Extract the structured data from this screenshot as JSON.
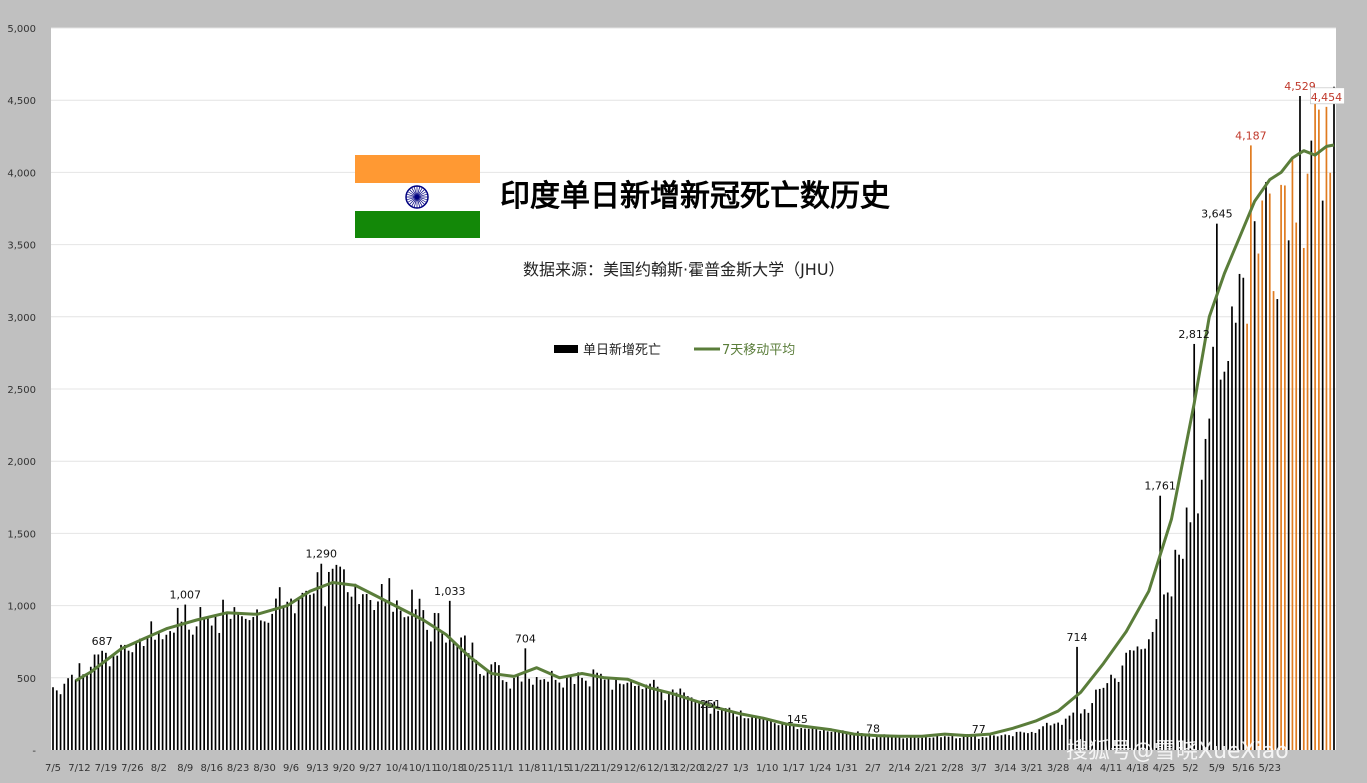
{
  "chart_data": {
    "type": "bar",
    "title": "印度单日新增新冠死亡数历史",
    "subtitle": "数据来源：美国约翰斯·霍普金斯大学（JHU）",
    "legend": {
      "placement": "center",
      "bar_label": "单日新增死亡",
      "line_label": "7天移动平均"
    },
    "watermark": "搜狐号@雪晓XueXiao",
    "ylim": [
      0,
      5000
    ],
    "y_ticks": [
      "-",
      "500",
      "1,000",
      "1,500",
      "2,000",
      "2,500",
      "3,000",
      "3,500",
      "4,000",
      "4,500",
      "5,000"
    ],
    "x_ticks": [
      "7/5",
      "7/12",
      "7/19",
      "7/26",
      "8/2",
      "8/9",
      "8/16",
      "8/23",
      "8/30",
      "9/6",
      "9/13",
      "9/20",
      "9/27",
      "10/4",
      "10/11",
      "10/18",
      "10/25",
      "11/1",
      "11/8",
      "11/15",
      "11/22",
      "11/29",
      "12/6",
      "12/13",
      "12/20",
      "12/27",
      "1/3",
      "1/10",
      "1/17",
      "1/24",
      "1/31",
      "2/7",
      "2/14",
      "2/21",
      "2/28",
      "3/7",
      "3/14",
      "3/21",
      "3/28",
      "4/4",
      "4/11",
      "4/18",
      "4/25",
      "5/2",
      "5/9",
      "5/16",
      "5/23"
    ],
    "series": [
      {
        "name": "单日新增死亡",
        "type": "bar",
        "colors": {
          "default": "#000000",
          "recent": "#e07b1f"
        },
        "keypoints": [
          {
            "day": 0,
            "value": 440
          },
          {
            "day": 14,
            "value": 680
          },
          {
            "day": 21,
            "value": 760
          },
          {
            "day": 35,
            "value": 920
          },
          {
            "day": 42,
            "value": 960
          },
          {
            "day": 56,
            "value": 1000
          },
          {
            "day": 63,
            "value": 1060
          },
          {
            "day": 70,
            "value": 1180
          },
          {
            "day": 77,
            "value": 1170
          },
          {
            "day": 84,
            "value": 1120
          },
          {
            "day": 91,
            "value": 1080
          },
          {
            "day": 98,
            "value": 960
          },
          {
            "day": 105,
            "value": 820
          },
          {
            "day": 112,
            "value": 680
          },
          {
            "day": 119,
            "value": 530
          },
          {
            "day": 126,
            "value": 530
          },
          {
            "day": 133,
            "value": 540
          },
          {
            "day": 140,
            "value": 510
          },
          {
            "day": 147,
            "value": 520
          },
          {
            "day": 154,
            "value": 500
          },
          {
            "day": 161,
            "value": 430
          },
          {
            "day": 168,
            "value": 380
          },
          {
            "day": 175,
            "value": 310
          },
          {
            "day": 182,
            "value": 250
          },
          {
            "day": 189,
            "value": 210
          },
          {
            "day": 196,
            "value": 170
          },
          {
            "day": 203,
            "value": 150
          },
          {
            "day": 210,
            "value": 130
          },
          {
            "day": 217,
            "value": 105
          },
          {
            "day": 224,
            "value": 95
          },
          {
            "day": 231,
            "value": 95
          },
          {
            "day": 238,
            "value": 100
          },
          {
            "day": 245,
            "value": 105
          },
          {
            "day": 252,
            "value": 100
          },
          {
            "day": 259,
            "value": 135
          },
          {
            "day": 266,
            "value": 200
          },
          {
            "day": 273,
            "value": 280
          },
          {
            "day": 280,
            "value": 520
          },
          {
            "day": 287,
            "value": 720
          },
          {
            "day": 294,
            "value": 1030
          },
          {
            "day": 301,
            "value": 1650
          },
          {
            "day": 308,
            "value": 2700
          },
          {
            "day": 315,
            "value": 3450
          },
          {
            "day": 322,
            "value": 3900
          },
          {
            "day": 329,
            "value": 4050
          },
          {
            "day": 336,
            "value": 4150
          },
          {
            "day": 339,
            "value": 4180
          }
        ],
        "recent_from_day": 315,
        "annotations": [
          {
            "day": 13,
            "value": 687,
            "label": "687"
          },
          {
            "day": 35,
            "value": 1007,
            "label": "1,007"
          },
          {
            "day": 71,
            "value": 1290,
            "label": "1,290"
          },
          {
            "day": 105,
            "value": 1033,
            "label": "1,033"
          },
          {
            "day": 125,
            "value": 704,
            "label": "704"
          },
          {
            "day": 174,
            "value": 251,
            "label": "251"
          },
          {
            "day": 197,
            "value": 145,
            "label": "145"
          },
          {
            "day": 217,
            "value": 78,
            "label": "78"
          },
          {
            "day": 245,
            "value": 77,
            "label": "77"
          },
          {
            "day": 271,
            "value": 714,
            "label": "714"
          },
          {
            "day": 293,
            "value": 1761,
            "label": "1,761"
          },
          {
            "day": 302,
            "value": 2812,
            "label": "2,812"
          },
          {
            "day": 308,
            "value": 3645,
            "label": "3,645"
          },
          {
            "day": 317,
            "value": 4187,
            "label": "4,187",
            "color": "#c0392b"
          },
          {
            "day": 330,
            "value": 4529,
            "label": "4,529",
            "color": "#c0392b"
          },
          {
            "day": 337,
            "value": 4454,
            "label": "4,454",
            "color": "#c0392b",
            "boxed": true
          }
        ]
      },
      {
        "name": "7天移动平均",
        "type": "line",
        "color": "#5a7d3a",
        "points": [
          {
            "day": 6,
            "value": 480
          },
          {
            "day": 10,
            "value": 540
          },
          {
            "day": 14,
            "value": 620
          },
          {
            "day": 18,
            "value": 700
          },
          {
            "day": 24,
            "value": 770
          },
          {
            "day": 30,
            "value": 840
          },
          {
            "day": 38,
            "value": 900
          },
          {
            "day": 46,
            "value": 950
          },
          {
            "day": 54,
            "value": 940
          },
          {
            "day": 62,
            "value": 1000
          },
          {
            "day": 68,
            "value": 1100
          },
          {
            "day": 74,
            "value": 1160
          },
          {
            "day": 80,
            "value": 1140
          },
          {
            "day": 86,
            "value": 1060
          },
          {
            "day": 92,
            "value": 980
          },
          {
            "day": 98,
            "value": 900
          },
          {
            "day": 104,
            "value": 800
          },
          {
            "day": 110,
            "value": 650
          },
          {
            "day": 116,
            "value": 530
          },
          {
            "day": 122,
            "value": 510
          },
          {
            "day": 128,
            "value": 570
          },
          {
            "day": 134,
            "value": 500
          },
          {
            "day": 140,
            "value": 530
          },
          {
            "day": 146,
            "value": 500
          },
          {
            "day": 152,
            "value": 490
          },
          {
            "day": 158,
            "value": 430
          },
          {
            "day": 164,
            "value": 390
          },
          {
            "day": 170,
            "value": 340
          },
          {
            "day": 176,
            "value": 290
          },
          {
            "day": 182,
            "value": 250
          },
          {
            "day": 188,
            "value": 220
          },
          {
            "day": 194,
            "value": 180
          },
          {
            "day": 200,
            "value": 160
          },
          {
            "day": 206,
            "value": 140
          },
          {
            "day": 212,
            "value": 110
          },
          {
            "day": 218,
            "value": 100
          },
          {
            "day": 224,
            "value": 95
          },
          {
            "day": 230,
            "value": 95
          },
          {
            "day": 236,
            "value": 110
          },
          {
            "day": 242,
            "value": 100
          },
          {
            "day": 248,
            "value": 110
          },
          {
            "day": 254,
            "value": 150
          },
          {
            "day": 260,
            "value": 200
          },
          {
            "day": 266,
            "value": 270
          },
          {
            "day": 272,
            "value": 400
          },
          {
            "day": 278,
            "value": 600
          },
          {
            "day": 284,
            "value": 820
          },
          {
            "day": 290,
            "value": 1100
          },
          {
            "day": 296,
            "value": 1600
          },
          {
            "day": 302,
            "value": 2400
          },
          {
            "day": 306,
            "value": 3000
          },
          {
            "day": 310,
            "value": 3300
          },
          {
            "day": 314,
            "value": 3550
          },
          {
            "day": 318,
            "value": 3800
          },
          {
            "day": 322,
            "value": 3950
          },
          {
            "day": 325,
            "value": 4000
          },
          {
            "day": 328,
            "value": 4100
          },
          {
            "day": 331,
            "value": 4150
          },
          {
            "day": 334,
            "value": 4120
          },
          {
            "day": 337,
            "value": 4180
          },
          {
            "day": 339,
            "value": 4190
          }
        ]
      }
    ],
    "flag": {
      "top_color": "#ff9933",
      "middle_color": "#ffffff",
      "bottom_color": "#138808",
      "wheel_color": "#000080"
    }
  }
}
